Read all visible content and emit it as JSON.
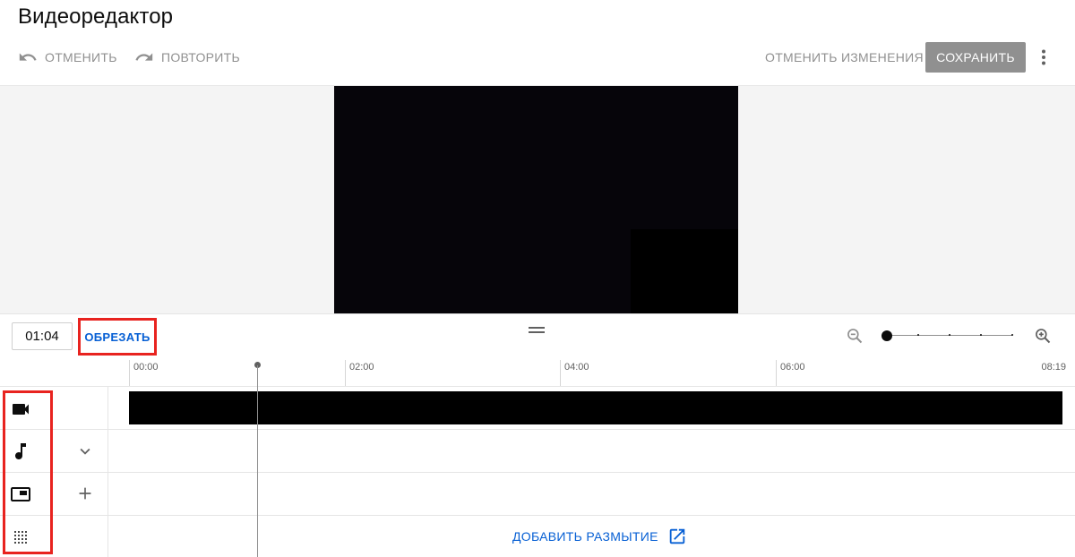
{
  "app": {
    "title": "Видеоредактор"
  },
  "toolbar": {
    "undo_label": "ОТМЕНИТЬ",
    "redo_label": "ПОВТОРИТЬ",
    "discard_label": "ОТМЕНИТЬ ИЗМЕНЕНИЯ",
    "save_label": "СОХРАНИТЬ"
  },
  "controls": {
    "current_time": "01:04",
    "trim_label": "ОБРЕЗАТЬ",
    "zoom_level": 0
  },
  "timeline": {
    "ticks": [
      "00:00",
      "02:00",
      "04:00",
      "06:00"
    ],
    "end_time": "08:19",
    "playhead_time": "01:04"
  },
  "tracks": {
    "icons": [
      "video-camera-icon",
      "music-note-icon",
      "end-screen-icon",
      "blur-icon"
    ],
    "add_blur_label": "ДОБАВИТЬ РАЗМЫТИЕ"
  },
  "colors": {
    "accent_blue": "#065fd4",
    "highlight_red": "#e8231f",
    "disabled_gray": "#909090"
  }
}
